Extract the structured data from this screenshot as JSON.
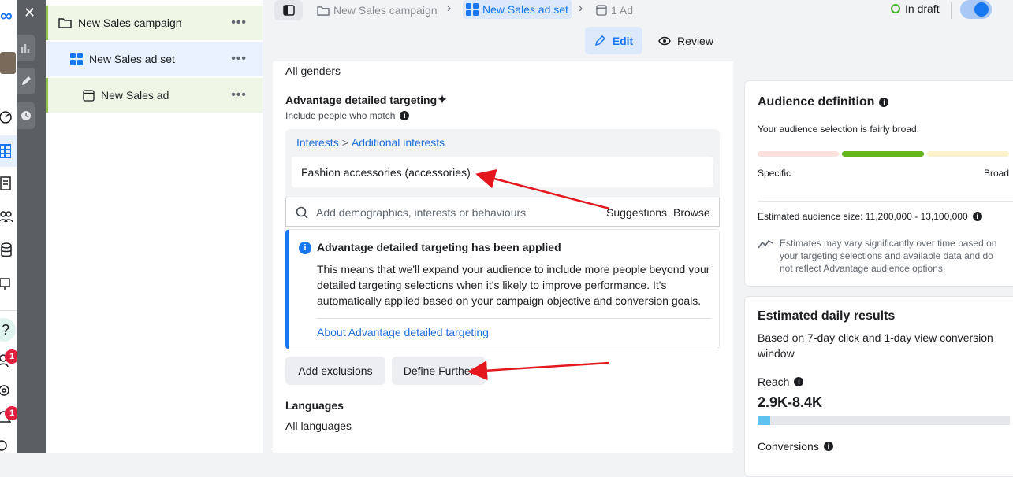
{
  "tree": {
    "campaign": "New Sales campaign",
    "adset": "New Sales ad set",
    "ad": "New Sales ad",
    "more": "•••"
  },
  "topbar": {
    "crumb_campaign": "New Sales campaign",
    "crumb_adset": "New Sales ad set",
    "crumb_ad": "1 Ad",
    "status": "In draft",
    "edit": "Edit",
    "review": "Review"
  },
  "form": {
    "genders_value": "All genders",
    "detailed_title": "Advantage detailed targeting",
    "include_label": "Include people who match",
    "crumb_interests": "Interests",
    "crumb_sep": ">",
    "crumb_additional": "Additional interests",
    "selected_interest": "Fashion accessories (accessories)",
    "search_placeholder": "Add demographics, interests or behaviours",
    "suggestions": "Suggestions",
    "browse": "Browse",
    "notice_title": "Advantage detailed targeting has been applied",
    "notice_body": "This means that we'll expand your audience to include more people beyond your detailed targeting selections when it's likely to improve performance. It's automatically applied based on your campaign objective and conversion goals.",
    "notice_link": "About Advantage detailed targeting",
    "add_exclusions": "Add exclusions",
    "define_further": "Define Further",
    "languages_title": "Languages",
    "languages_value": "All languages"
  },
  "audience": {
    "title": "Audience definition",
    "subtitle": "Your audience selection is fairly broad.",
    "specific": "Specific",
    "broad": "Broad",
    "size": "Estimated audience size: 11,200,000 - 13,100,000",
    "note": "Estimates may vary significantly over time based on your targeting selections and available data and do not reflect Advantage audience options.",
    "gauge_level": "2 of 3 segments (broad-leaning middle)"
  },
  "results": {
    "title": "Estimated daily results",
    "subtitle": "Based on 7-day click and 1-day view conversion window",
    "reach_label": "Reach",
    "reach_value": "2.9K-8.4K",
    "conversions_label": "Conversions",
    "reach_bar_fraction": 0.05
  },
  "badges": {
    "people_count": "1",
    "bell_count": "1"
  },
  "colors": {
    "accent_blue": "#1877f2",
    "link_blue": "#216fdb",
    "gauge_red": "#fbe0dd",
    "gauge_green": "#63b51b",
    "gauge_yellow": "#fdf0cd",
    "annotation_red": "#e4171d",
    "status_green": "#42b72a",
    "badge_red": "#e41e3f"
  }
}
